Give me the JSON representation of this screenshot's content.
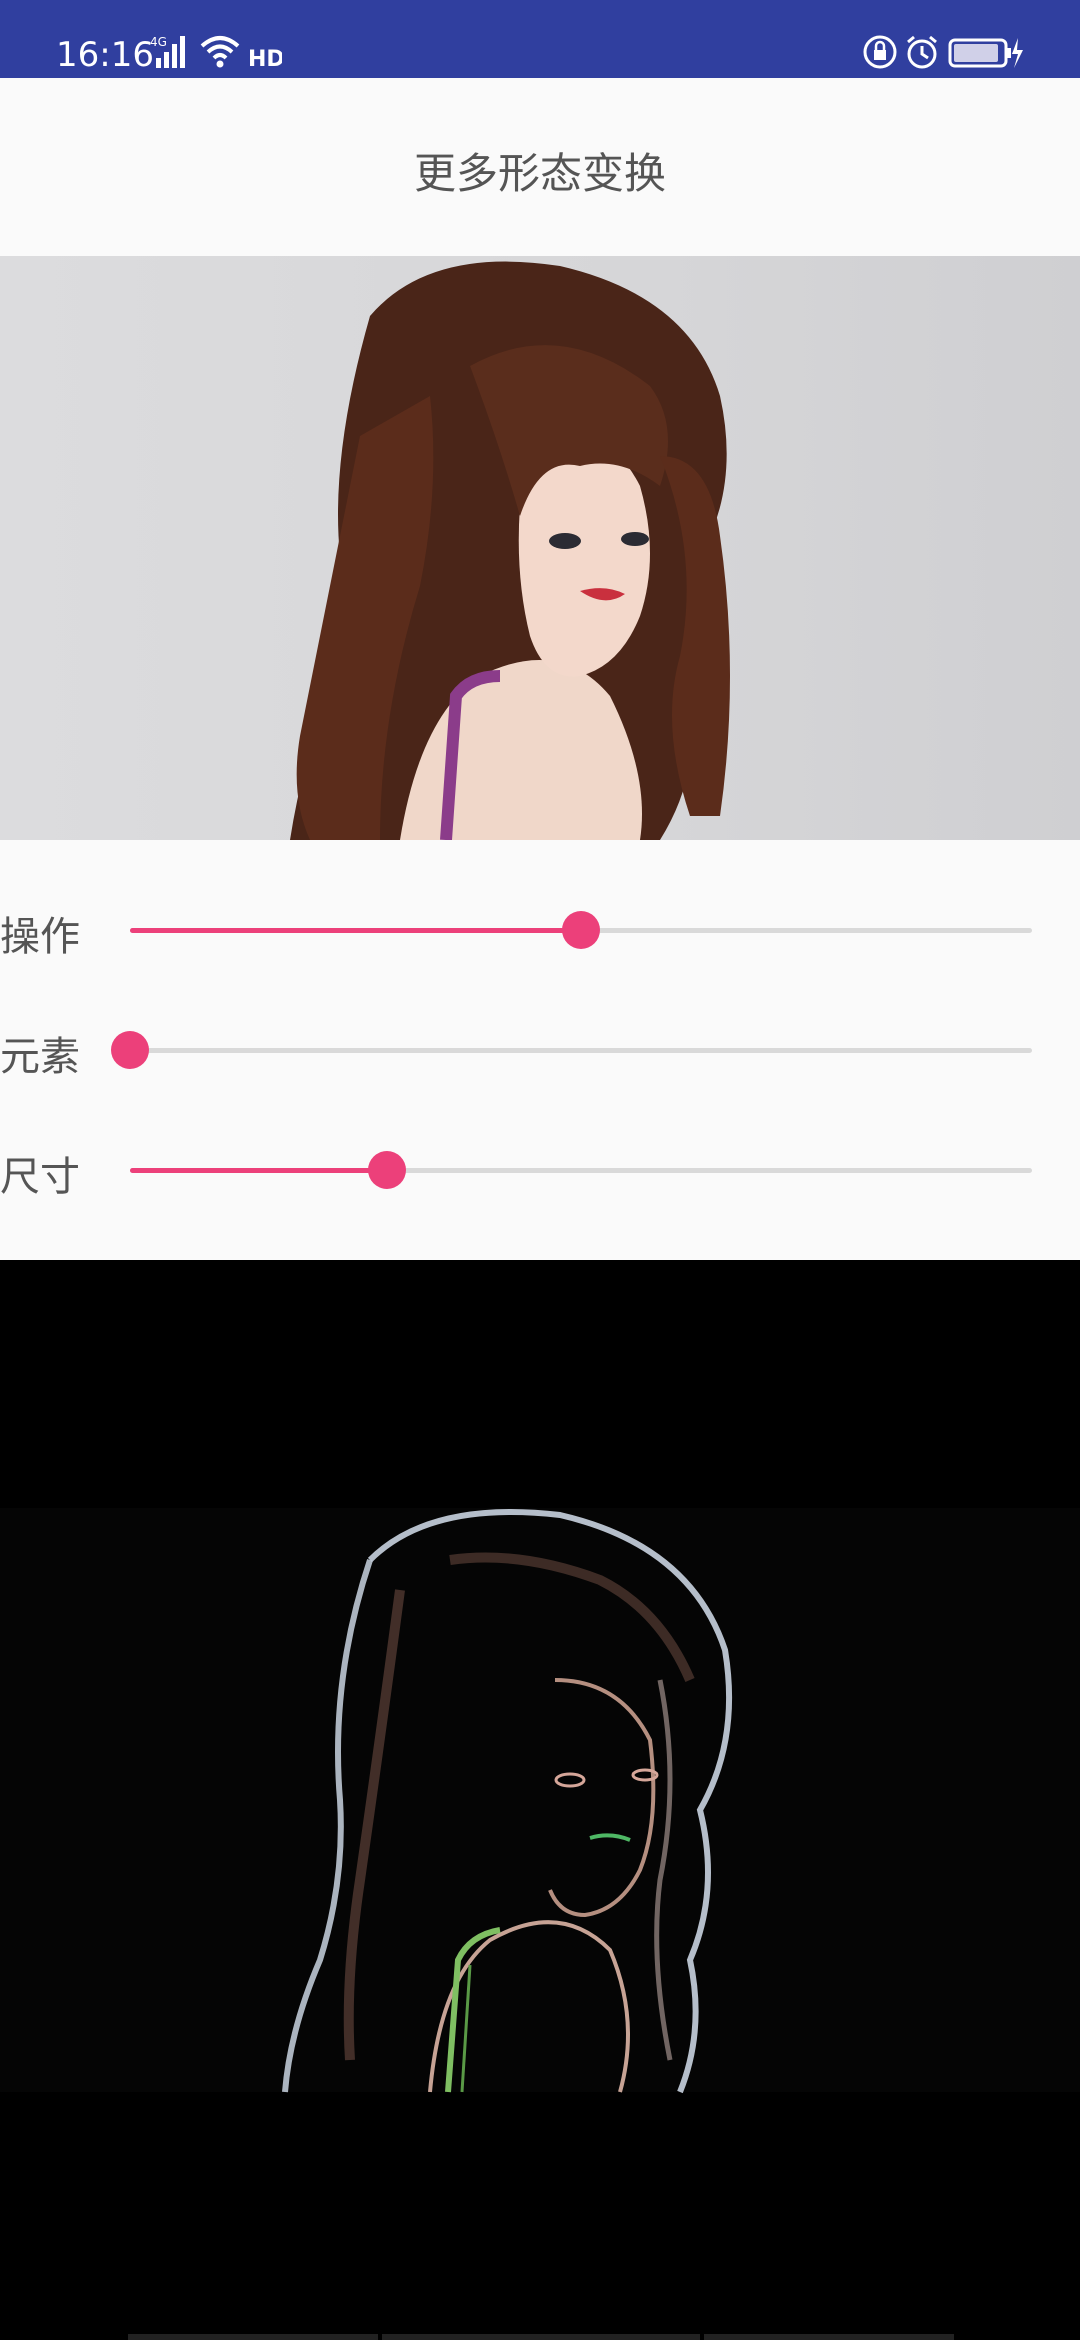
{
  "status_bar": {
    "time": "16:16",
    "network": "4G",
    "icons": [
      "signal-icon",
      "wifi-icon",
      "hd-icon",
      "lock-rotation-icon",
      "alarm-icon",
      "battery-charging-icon"
    ]
  },
  "title": "更多形态变换",
  "sliders": [
    {
      "label": "操作",
      "value": 0.5
    },
    {
      "label": "元素",
      "value": 0.0
    },
    {
      "label": "尺寸",
      "value": 0.285
    }
  ],
  "colors": {
    "status_bar": "#303f9f",
    "accent": "#ec407a",
    "track": "#d9d9d9",
    "result_bg": "#000000"
  }
}
